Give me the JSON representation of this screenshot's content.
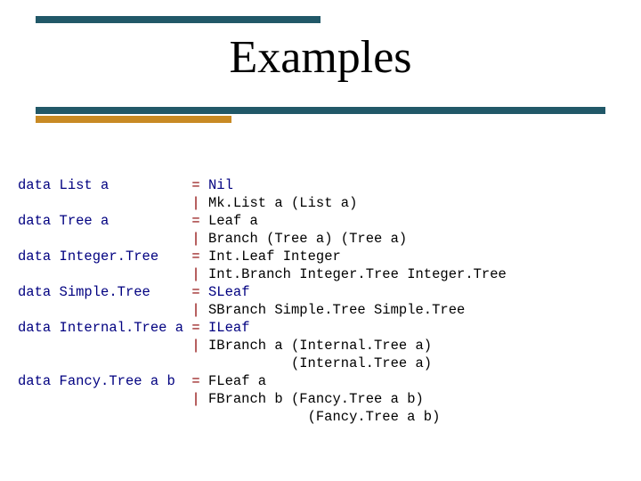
{
  "title": "Examples",
  "code": {
    "eq": "=",
    "bar": "|",
    "lines": [
      {
        "kw": "data",
        "ty": "List a",
        "rhs": "Nil"
      },
      {
        "rhs": "Mk.List a (List a)"
      },
      {
        "kw": "data",
        "ty": "Tree a",
        "rhs": "Leaf a"
      },
      {
        "rhs": "Branch (Tree a) (Tree a)"
      },
      {
        "kw": "data",
        "ty": "Integer.Tree",
        "rhs": "Int.Leaf Integer"
      },
      {
        "rhs": "Int.Branch Integer.Tree Integer.Tree"
      },
      {
        "kw": "data",
        "ty": "Simple.Tree",
        "rhs": "SLeaf"
      },
      {
        "rhs": "SBranch Simple.Tree Simple.Tree"
      },
      {
        "kw": "data",
        "ty": "Internal.Tree a",
        "rhs": "ILeaf"
      },
      {
        "rhs": "IBranch a (Internal.Tree a)"
      },
      {
        "rhs": "(Internal.Tree a)"
      },
      {
        "kw": "data",
        "ty": "Fancy.Tree a b",
        "rhs": "FLeaf a"
      },
      {
        "rhs": "FBranch b (Fancy.Tree a b)"
      },
      {
        "rhs": "(Fancy.Tree a b)"
      }
    ]
  }
}
